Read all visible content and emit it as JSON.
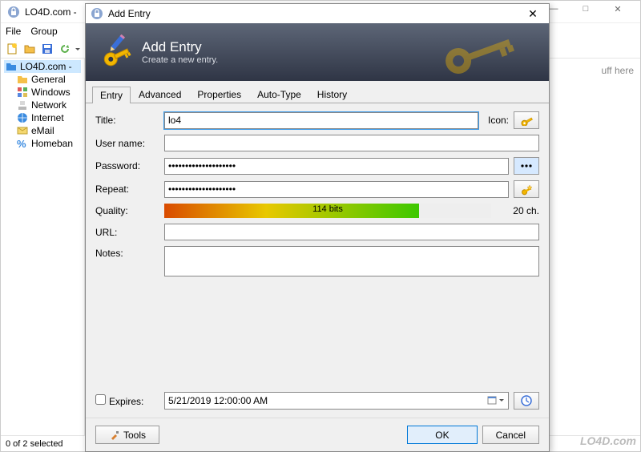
{
  "main": {
    "title": "LO4D.com -",
    "menubar": [
      "File",
      "Group"
    ],
    "tree": {
      "root": "LO4D.com -",
      "items": [
        {
          "label": "General",
          "icon": "folder"
        },
        {
          "label": "Windows",
          "icon": "windows"
        },
        {
          "label": "Network",
          "icon": "network"
        },
        {
          "label": "Internet",
          "icon": "globe"
        },
        {
          "label": "eMail",
          "icon": "mail"
        },
        {
          "label": "Homeban",
          "icon": "percent"
        }
      ]
    },
    "content_hint": "uff here",
    "statusbar": "0 of 2 selected"
  },
  "dialog": {
    "title": "Add Entry",
    "header_title": "Add Entry",
    "header_sub": "Create a new entry.",
    "tabs": [
      "Entry",
      "Advanced",
      "Properties",
      "Auto-Type",
      "History"
    ],
    "active_tab": 0,
    "fields": {
      "title_label": "Title:",
      "title_value": "lo4",
      "icon_label": "Icon:",
      "username_label": "User name:",
      "username_value": "",
      "password_label": "Password:",
      "password_value": "••••••••••••••••••••",
      "repeat_label": "Repeat:",
      "repeat_value": "••••••••••••••••••••",
      "quality_label": "Quality:",
      "quality_bits": "114 bits",
      "quality_chars": "20 ch.",
      "url_label": "URL:",
      "url_value": "",
      "notes_label": "Notes:",
      "notes_value": "",
      "expires_label": "Expires:",
      "expires_value": "5/21/2019 12:00:00 AM"
    },
    "footer": {
      "tools": "Tools",
      "ok": "OK",
      "cancel": "Cancel"
    }
  },
  "watermark": "LO4D.com"
}
